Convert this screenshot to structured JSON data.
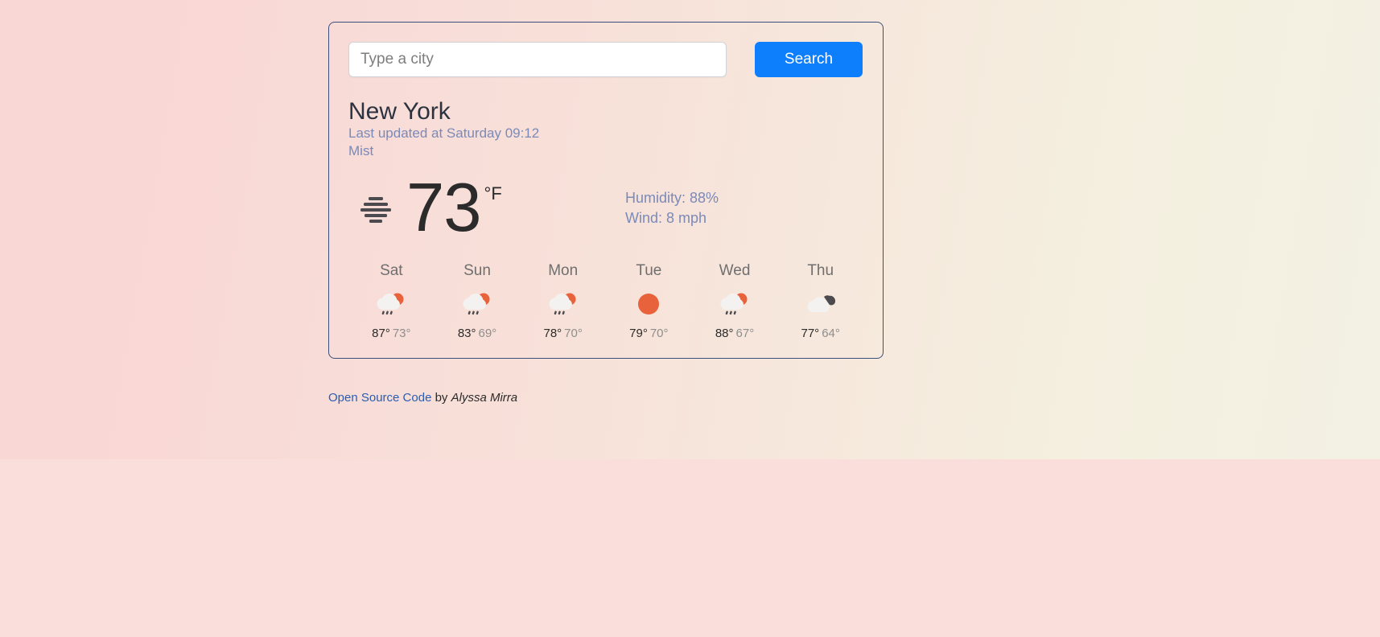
{
  "theme": {
    "accent_blue": "#0d7efc",
    "card_border": "#3b4f7d",
    "muted_blue": "#7b8ab8",
    "bg_left": "#f9d7d5",
    "bg_right": "#f3f1e4",
    "sun_orange": "#e8623c"
  },
  "search": {
    "placeholder": "Type a city",
    "value": "",
    "button_label": "Search"
  },
  "current": {
    "city": "New York",
    "last_updated": "Last updated at Saturday 09:12",
    "description": "Mist",
    "icon": "mist-icon",
    "temperature": "73",
    "unit": "°F",
    "humidity": "Humidity: 88%",
    "wind": "Wind: 8 mph"
  },
  "forecast": [
    {
      "day": "Sat",
      "icon": "sun-behind-rain-cloud-icon",
      "high": "87°",
      "low": "73°"
    },
    {
      "day": "Sun",
      "icon": "sun-behind-rain-cloud-icon",
      "high": "83°",
      "low": "69°"
    },
    {
      "day": "Mon",
      "icon": "sun-behind-rain-cloud-icon",
      "high": "78°",
      "low": "70°"
    },
    {
      "day": "Tue",
      "icon": "sun-icon",
      "high": "79°",
      "low": "70°"
    },
    {
      "day": "Wed",
      "icon": "sun-behind-rain-cloud-icon",
      "high": "88°",
      "low": "67°"
    },
    {
      "day": "Thu",
      "icon": "broken-clouds-icon",
      "high": "77°",
      "low": "64°"
    }
  ],
  "footer": {
    "link_text": "Open Source Code",
    "by_text": " by ",
    "author": "Alyssa Mirra"
  }
}
